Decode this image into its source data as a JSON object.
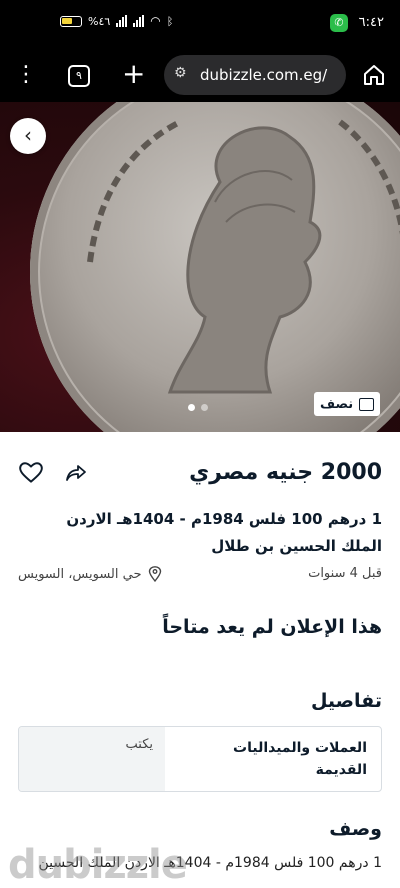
{
  "status_bar": {
    "time": "٦:٤٢",
    "battery_text": "%٤٦"
  },
  "browser": {
    "tab_count": "٩",
    "url": "dubizzle.com.eg/"
  },
  "gallery": {
    "media_label": "نصف",
    "image_count": 2,
    "active_index": 1
  },
  "listing": {
    "price": "2000 جنيه مصري",
    "title_line1": "1 درهم 100 فلس 1984م - 1404هـ الاردن",
    "title_line2": "الملك الحسين بن طلال",
    "posted": "قبل 4 سنوات",
    "location": "حي السويس، السويس",
    "unavailable_notice": "هذا الإعلان لم يعد متاحاً"
  },
  "details": {
    "heading": "تفاصيل",
    "rows": [
      {
        "value": "العملات والميداليات القديمة",
        "key": "يكتب"
      }
    ]
  },
  "description": {
    "heading": "وصف",
    "text": "1 درهم 100 فلس 1984م - 1404هـ الاردن الملك الحسين"
  },
  "watermark": "dubizzle",
  "colors": {
    "primary_text": "#0d1b2a",
    "status_call": "#2bbd4a"
  }
}
